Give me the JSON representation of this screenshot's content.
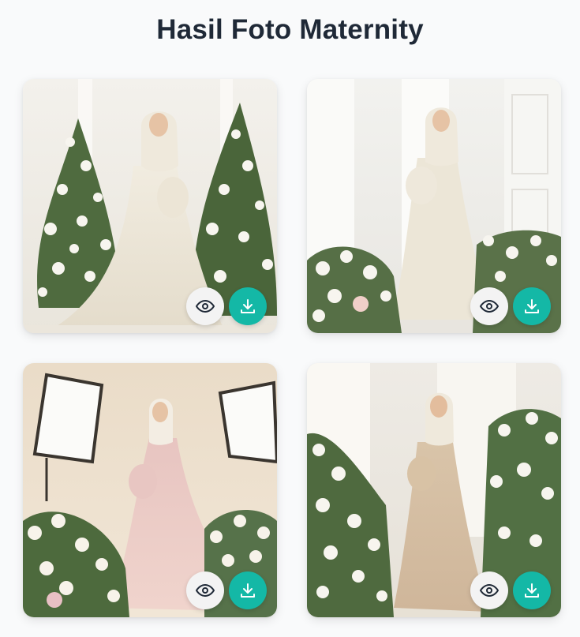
{
  "page": {
    "title": "Hasil Foto Maternity"
  },
  "gallery": {
    "photos": [
      {
        "scene": "white-dress-flower-trees"
      },
      {
        "scene": "white-dress-window-room"
      },
      {
        "scene": "pink-dress-studio-softbox"
      },
      {
        "scene": "beige-dress-flowers-room"
      }
    ],
    "icons": {
      "view": "eye-icon",
      "download": "download-icon"
    }
  },
  "colors": {
    "title": "#1f2937",
    "view_button_bg": "#f3f3f3",
    "download_button_bg": "#14b8a6",
    "page_bg": "#f9fafb"
  }
}
